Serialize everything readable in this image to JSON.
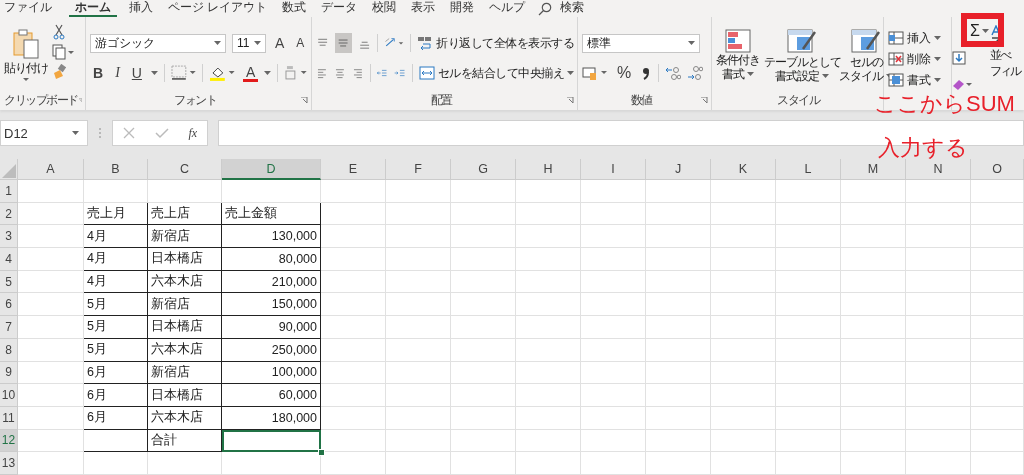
{
  "tabs": [
    {
      "label": "ファイル",
      "selected": false
    },
    {
      "label": "ホーム",
      "selected": true
    },
    {
      "label": "挿入",
      "selected": false
    },
    {
      "label": "ページ レイアウト",
      "selected": false
    },
    {
      "label": "数式",
      "selected": false
    },
    {
      "label": "データ",
      "selected": false
    },
    {
      "label": "校閲",
      "selected": false
    },
    {
      "label": "表示",
      "selected": false
    },
    {
      "label": "開発",
      "selected": false
    },
    {
      "label": "ヘルプ",
      "selected": false
    }
  ],
  "search": {
    "label": "検索"
  },
  "clipboard": {
    "paste": "貼り付け",
    "label": "クリップボード"
  },
  "font": {
    "name": "游ゴシック",
    "size": "11",
    "grow": "A",
    "shrink": "A",
    "bold": "B",
    "italic": "I",
    "underline": "U",
    "color_button": "A",
    "label": "フォント"
  },
  "alignment": {
    "wrap": "折り返して全体を表示する",
    "merge": "セルを結合して中央揃え",
    "label": "配置"
  },
  "number": {
    "format": "標準",
    "percent": "%",
    "label": "数値"
  },
  "styles": {
    "items": [
      {
        "line1": "条件付き",
        "line2": "書式"
      },
      {
        "line1": "テーブルとして",
        "line2": "書式設定"
      },
      {
        "line1": "セルの",
        "line2": "スタイル"
      }
    ],
    "label": "スタイル"
  },
  "cells": {
    "items": [
      "挿入",
      "削除",
      "書式"
    ]
  },
  "editing": {
    "sum": "Σ",
    "sort": "並べ",
    "fill": "フィル"
  },
  "name_box": "D12",
  "formula": {
    "fx": "fx"
  },
  "columns": [
    {
      "label": "A",
      "selected": false
    },
    {
      "label": "B",
      "selected": false
    },
    {
      "label": "C",
      "selected": false
    },
    {
      "label": "D",
      "selected": true
    },
    {
      "label": "E",
      "selected": false
    },
    {
      "label": "F",
      "selected": false
    },
    {
      "label": "G",
      "selected": false
    },
    {
      "label": "H",
      "selected": false
    },
    {
      "label": "I",
      "selected": false
    },
    {
      "label": "J",
      "selected": false
    },
    {
      "label": "K",
      "selected": false
    },
    {
      "label": "L",
      "selected": false
    },
    {
      "label": "M",
      "selected": false
    },
    {
      "label": "N",
      "selected": false
    },
    {
      "label": "O",
      "selected": false
    }
  ],
  "rows": [
    {
      "label": "1",
      "selected": false
    },
    {
      "label": "2",
      "selected": false,
      "kind": "header",
      "cells": {
        "B": "売上月",
        "C": "売上店",
        "D": "売上金額"
      }
    },
    {
      "label": "3",
      "selected": false,
      "kind": "data",
      "cells": {
        "B": "4月",
        "C": "新宿店",
        "D": "130,000"
      }
    },
    {
      "label": "4",
      "selected": false,
      "kind": "data",
      "cells": {
        "B": "4月",
        "C": "日本橋店",
        "D": "80,000"
      }
    },
    {
      "label": "5",
      "selected": false,
      "kind": "data",
      "cells": {
        "B": "4月",
        "C": "六本木店",
        "D": "210,000"
      }
    },
    {
      "label": "6",
      "selected": false,
      "kind": "data",
      "cells": {
        "B": "5月",
        "C": "新宿店",
        "D": "150,000"
      }
    },
    {
      "label": "7",
      "selected": false,
      "kind": "data",
      "cells": {
        "B": "5月",
        "C": "日本橋店",
        "D": "90,000"
      }
    },
    {
      "label": "8",
      "selected": false,
      "kind": "data",
      "cells": {
        "B": "5月",
        "C": "六本木店",
        "D": "250,000"
      }
    },
    {
      "label": "9",
      "selected": false,
      "kind": "data",
      "cells": {
        "B": "6月",
        "C": "新宿店",
        "D": "100,000"
      }
    },
    {
      "label": "10",
      "selected": false,
      "kind": "data",
      "cells": {
        "B": "6月",
        "C": "日本橋店",
        "D": "60,000"
      }
    },
    {
      "label": "11",
      "selected": false,
      "kind": "data",
      "cells": {
        "B": "6月",
        "C": "六本木店",
        "D": "180,000"
      }
    },
    {
      "label": "12",
      "selected": true,
      "kind": "total",
      "cells": {
        "C": "合計"
      }
    },
    {
      "label": "13",
      "selected": false
    }
  ],
  "annotation": {
    "lines": [
      "ここからSUM",
      "入力する"
    ]
  }
}
